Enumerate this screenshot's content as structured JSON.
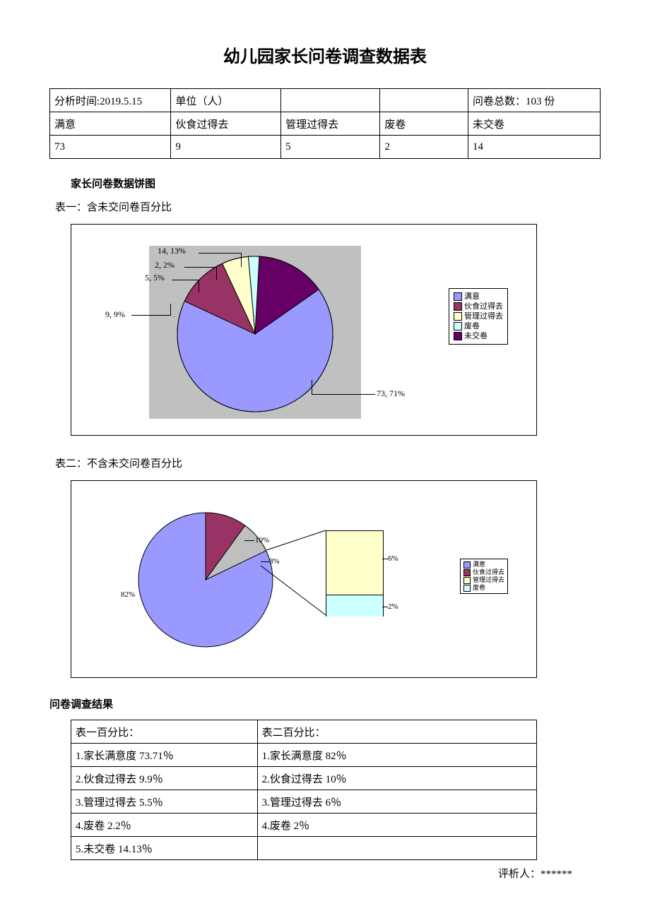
{
  "title": "幼儿园家长问卷调查数据表",
  "table1": {
    "r1c1": "分析时间:2019.5.15",
    "r1c2": "单位（人）",
    "r1c3": "",
    "r1c4": "",
    "r1c5": "问卷总数：103 份",
    "r2c1": "满意",
    "r2c2": "伙食过得去",
    "r2c3": "管理过得去",
    "r2c4": "废卷",
    "r2c5": "未交卷",
    "r3c1": "73",
    "r3c2": "9",
    "r3c3": "5",
    "r3c4": "2",
    "r3c5": "14"
  },
  "sec1_title": "家长问卷数据饼图",
  "sub1": "表一：含未交问卷百分比",
  "legend_common": {
    "a": "满意",
    "b": "伙食过得去",
    "c": "管理过得去",
    "d": "废卷",
    "e": "未交卷"
  },
  "colors": {
    "a": "#9999ff",
    "b": "#993366",
    "c": "#ffffcc",
    "d": "#ccffff",
    "e": "#660066"
  },
  "chart1_labels": {
    "l73": "73, 71%",
    "l9": "9, 9%",
    "l5": "5, 5%",
    "l2": "2, 2%",
    "l14": "14, 13%"
  },
  "sub2": "表二：不含未交问卷百分比",
  "chart2_labels": {
    "p82": "82%",
    "p10": "10%",
    "p8": "8%",
    "p6": "6%",
    "p2": "2%"
  },
  "results_title": "问卷调查结果",
  "results": {
    "h1": "表一百分比：",
    "h2": "表二百分比：",
    "a1": "1.家长满意度 73.71％",
    "a2": "2.伙食过得去 9.9％",
    "a3": "3.管理过得去 5.5％",
    "a4": "4.废卷 2.2％",
    "a5": "5.未交卷 14.13％",
    "b1": "1.家长满意度 82％",
    "b2": "2.伙食过得去 10％",
    "b3": "3.管理过得去 6％",
    "b4": "4.废卷 2％"
  },
  "reviewer": "评析人：******",
  "chart_data": [
    {
      "type": "pie",
      "title": "表一：含未交问卷百分比",
      "series": [
        {
          "name": "满意",
          "value": 73,
          "pct": 71
        },
        {
          "name": "伙食过得去",
          "value": 9,
          "pct": 9
        },
        {
          "name": "管理过得去",
          "value": 5,
          "pct": 5
        },
        {
          "name": "废卷",
          "value": 2,
          "pct": 2
        },
        {
          "name": "未交卷",
          "value": 14,
          "pct": 13
        }
      ]
    },
    {
      "type": "pie",
      "title": "表二：不含未交问卷百分比",
      "series": [
        {
          "name": "满意",
          "pct": 82
        },
        {
          "name": "伙食过得去",
          "pct": 10
        },
        {
          "name": "管理过得去",
          "pct": 6
        },
        {
          "name": "废卷",
          "pct": 2
        }
      ],
      "bar_of_pie_slices": [
        {
          "name": "管理过得去",
          "pct": 6
        },
        {
          "name": "废卷",
          "pct": 2
        }
      ]
    }
  ]
}
